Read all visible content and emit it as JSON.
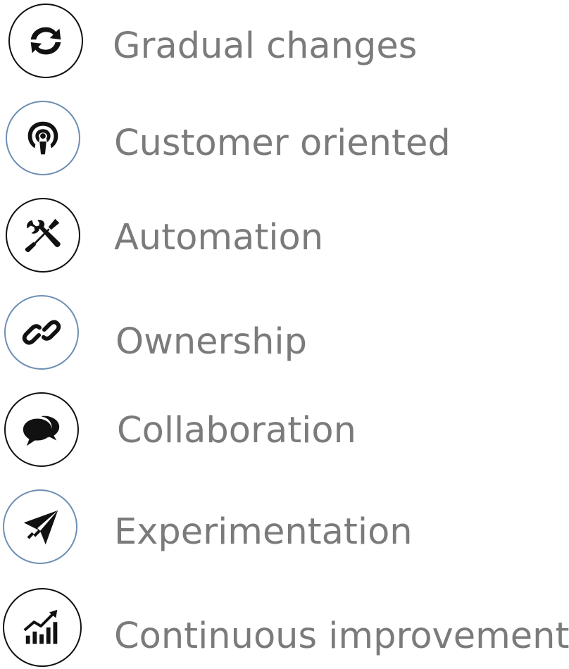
{
  "items": [
    {
      "label": "Gradual changes",
      "icon": "refresh-arrows-icon"
    },
    {
      "label": "Customer oriented",
      "icon": "podcast-icon"
    },
    {
      "label": "Automation",
      "icon": "wrench-screwdriver-icon"
    },
    {
      "label": "Ownership",
      "icon": "chain-link-icon"
    },
    {
      "label": "Collaboration",
      "icon": "speech-bubbles-icon"
    },
    {
      "label": "Experimentation",
      "icon": "paper-plane-icon"
    },
    {
      "label": "Continuous improvement",
      "icon": "growth-chart-icon"
    }
  ],
  "colors": {
    "text": "#7b7b7b",
    "icon": "#111111",
    "circle_border_dark": "#111111",
    "circle_border_blue": "#6f8fb3"
  }
}
